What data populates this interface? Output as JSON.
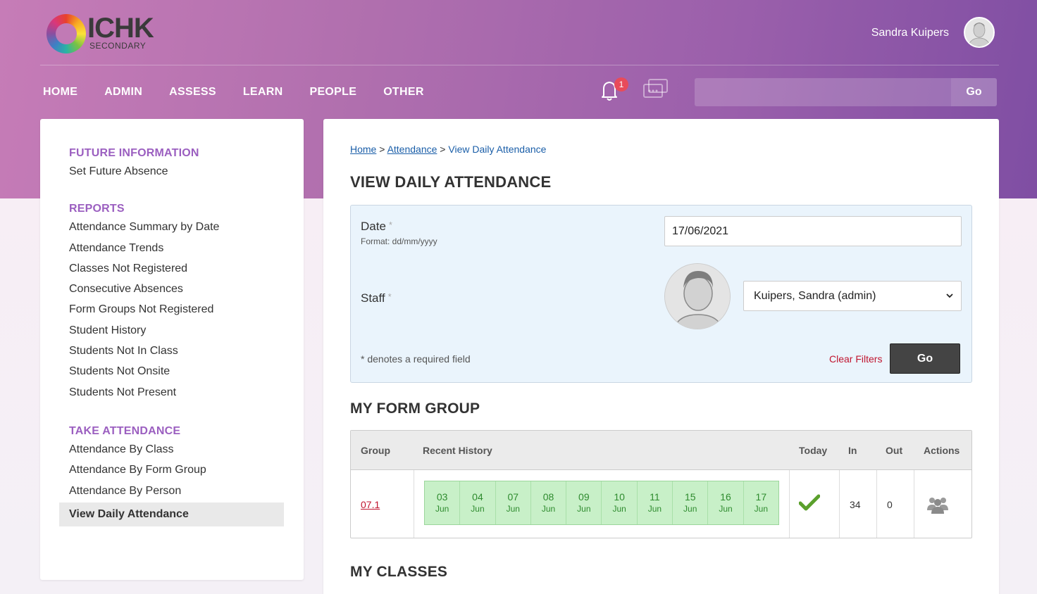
{
  "header": {
    "logo_text": "ICHK",
    "logo_subtext": "SECONDARY",
    "user_name": "Sandra Kuipers",
    "notification_count": "1",
    "search_placeholder": "",
    "search_go": "Go"
  },
  "nav": [
    "HOME",
    "ADMIN",
    "ASSESS",
    "LEARN",
    "PEOPLE",
    "OTHER"
  ],
  "sidebar": {
    "groups": [
      {
        "heading": "FUTURE INFORMATION",
        "items": [
          "Set Future Absence"
        ]
      },
      {
        "heading": "REPORTS",
        "items": [
          "Attendance Summary by Date",
          "Attendance Trends",
          "Classes Not Registered",
          "Consecutive Absences",
          "Form Groups Not Registered",
          "Student History",
          "Students Not In Class",
          "Students Not Onsite",
          "Students Not Present"
        ]
      },
      {
        "heading": "TAKE ATTENDANCE",
        "items": [
          "Attendance By Class",
          "Attendance By Form Group",
          "Attendance By Person",
          "View Daily Attendance"
        ]
      }
    ],
    "active_item": "View Daily Attendance"
  },
  "breadcrumb": {
    "home": "Home",
    "sep1": ">",
    "attendance": "Attendance",
    "sep2": ">",
    "current": "View Daily Attendance"
  },
  "page_title": "VIEW DAILY ATTENDANCE",
  "filters": {
    "date_label": "Date",
    "date_required": "*",
    "date_format": "Format: dd/mm/yyyy",
    "date_value": "17/06/2021",
    "staff_label": "Staff",
    "staff_required": "*",
    "staff_value": "Kuipers, Sandra (admin)",
    "required_note": "* denotes a required field",
    "clear_filters": "Clear Filters",
    "go": "Go"
  },
  "form_group": {
    "title": "MY FORM GROUP",
    "columns": [
      "Group",
      "Recent History",
      "Today",
      "In",
      "Out",
      "Actions"
    ],
    "row": {
      "group": "07.1",
      "history": [
        {
          "day": "03",
          "month": "Jun"
        },
        {
          "day": "04",
          "month": "Jun"
        },
        {
          "day": "07",
          "month": "Jun"
        },
        {
          "day": "08",
          "month": "Jun"
        },
        {
          "day": "09",
          "month": "Jun"
        },
        {
          "day": "10",
          "month": "Jun"
        },
        {
          "day": "11",
          "month": "Jun"
        },
        {
          "day": "15",
          "month": "Jun"
        },
        {
          "day": "16",
          "month": "Jun"
        },
        {
          "day": "17",
          "month": "Jun"
        }
      ],
      "today": "check-icon",
      "in": "34",
      "out": "0",
      "actions": "people-icon"
    }
  },
  "classes_title": "MY CLASSES",
  "colors": {
    "accent_purple": "#9b5fc0",
    "link_red": "#c0152f",
    "history_green": "#c8f0c8",
    "check_green": "#5aa02c"
  }
}
